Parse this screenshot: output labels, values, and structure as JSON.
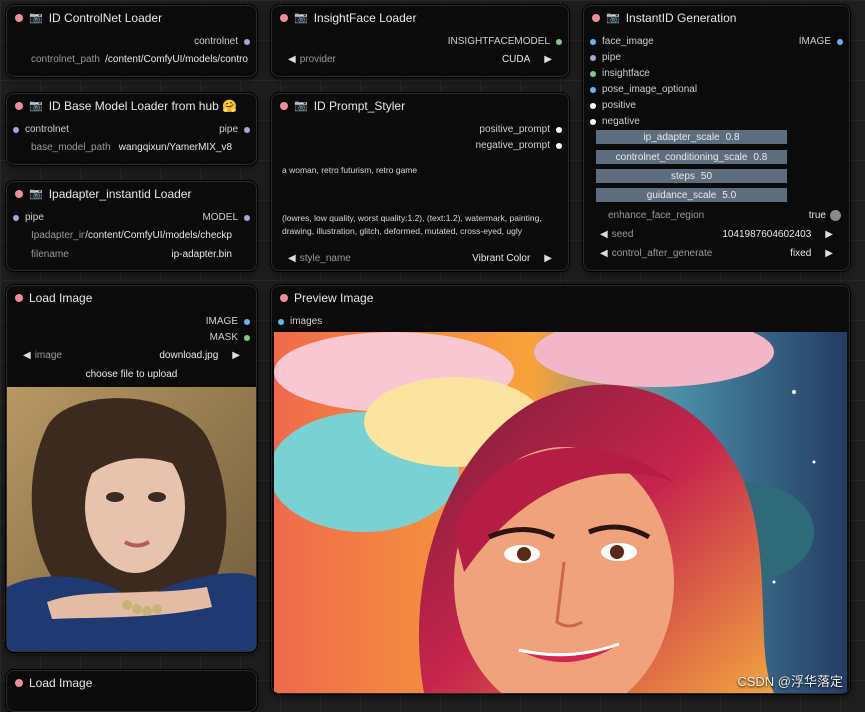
{
  "nodes": {
    "controlnet_loader": {
      "title": "ID ControlNet Loader",
      "output": "controlnet",
      "path_label": "controlnet_path",
      "path_value": "/content/ComfyUI/models/contro"
    },
    "insightface_loader": {
      "title": "InsightFace Loader",
      "output": "INSIGHTFACEMODEL",
      "provider_label": "provider",
      "provider_value": "CUDA"
    },
    "instantid_generation": {
      "title": "InstantID Generation",
      "inputs": [
        "face_image",
        "pipe",
        "insightface",
        "pose_image_optional",
        "positive",
        "negative"
      ],
      "output": "IMAGE",
      "sliders": [
        {
          "label": "ip_adapter_scale",
          "value": "0.8"
        },
        {
          "label": "controlnet_conditioning_scale",
          "value": "0.8"
        },
        {
          "label": "steps",
          "value": "50"
        },
        {
          "label": "guidance_scale",
          "value": "5.0"
        }
      ],
      "enhance_label": "enhance_face_region",
      "enhance_value": "true",
      "seed_label": "seed",
      "seed_value": "1041987604602403",
      "control_label": "control_after_generate",
      "control_value": "fixed"
    },
    "base_model_loader": {
      "title": "ID Base Model Loader from hub 🤗",
      "input": "controlnet",
      "output": "pipe",
      "model_label": "base_model_path",
      "model_value": "wangqixun/YamerMIX_v8"
    },
    "prompt_styler": {
      "title": "ID Prompt_Styler",
      "outputs": [
        "positive_prompt",
        "negative_prompt"
      ],
      "positive_text": "a woman, retro futurism, retro game",
      "negative_text": "(lowres, low quality, worst quality:1.2), (text:1.2), watermark, painting, drawing, illustration, glitch, deformed, mutated, cross-eyed, ugly",
      "style_label": "style_name",
      "style_value": "Vibrant Color"
    },
    "ipadapter_loader": {
      "title": "Ipadapter_instantid Loader",
      "input": "pipe",
      "output": "MODEL",
      "path_label": "Ipadapter_instantid_path",
      "path_value": "/content/ComfyUI/models/checkp",
      "filename_label": "filename",
      "filename_value": "ip-adapter.bin"
    },
    "load_image": {
      "title": "Load Image",
      "outputs": [
        "IMAGE",
        "MASK"
      ],
      "image_label": "image",
      "image_value": "download.jpg",
      "upload_label": "choose file to upload"
    },
    "preview_image": {
      "title": "Preview Image",
      "input": "images"
    },
    "load_image_2": {
      "title": "Load Image"
    }
  },
  "colors": {
    "title_dot": "#f28c9c",
    "image_socket": "#64b5f6",
    "mask_socket": "#81c784",
    "pipe_socket": "#b39ddb",
    "text_socket": "#ffffff"
  },
  "watermark": "CSDN @浮华落定"
}
